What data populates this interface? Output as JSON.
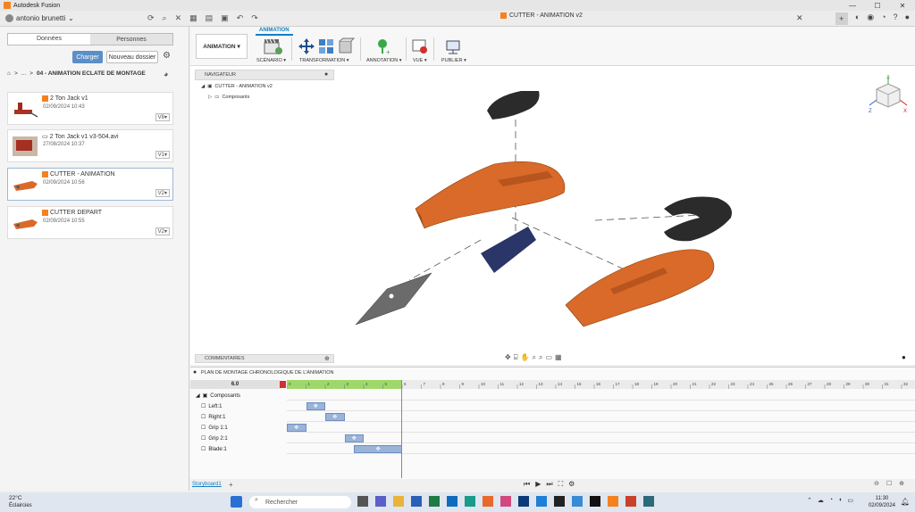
{
  "window": {
    "title": "Autodesk Fusion"
  },
  "appbar": {
    "user": "antonio brunetti"
  },
  "document": {
    "tab_title": "CUTTER - ANIMATION v2"
  },
  "left_panel": {
    "tabs": [
      "Données",
      "Personnes"
    ],
    "upload_label": "Charger",
    "new_folder_label": "Nouveau dossier",
    "breadcrumb": {
      "ellipsis": "...",
      "separator": ">",
      "folder": "04 - ANIMATION ECLATE DE MONTAGE"
    },
    "files": [
      {
        "name": "2 Ton Jack v1",
        "date": "02/09/2024 10:43",
        "version": "V8"
      },
      {
        "name": "2 Ton Jack v1 v3-504.avi",
        "date": "27/08/2024 10:37",
        "version": "V1"
      },
      {
        "name": "CUTTER - ANIMATION",
        "date": "02/09/2024 10:56",
        "version": "V2"
      },
      {
        "name": "CUTTER DEPART",
        "date": "02/09/2024 10:55",
        "version": "V2"
      }
    ]
  },
  "toolbar": {
    "workspace": "ANIMATION",
    "active_tab": "ANIMATION",
    "groups": [
      "SCÉNARIO",
      "TRANSFORMATION",
      "ANNOTATION",
      "VUE",
      "PUBLIER"
    ]
  },
  "browser": {
    "header": "NAVIGATEUR",
    "root": "CUTTER - ANIMATION v2",
    "child": "Composants",
    "comments": "COMMENTAIRES"
  },
  "viewcube": {
    "axis_y": "Y",
    "axis_z": "Z",
    "axis_x": "X"
  },
  "timeline": {
    "title": "PLAN DE MONTAGE CHRONOLOGIQUE DE L'ANIMATION",
    "time": "6.0",
    "root": "Composants",
    "tracks": [
      {
        "label": "Left:1",
        "start": 1,
        "end": 2
      },
      {
        "label": "Right:1",
        "start": 2,
        "end": 3
      },
      {
        "label": "Grip 1:1",
        "start": 0,
        "end": 1
      },
      {
        "label": "Grip 2:1",
        "start": 3,
        "end": 4
      },
      {
        "label": "Blade:1",
        "start": 3.5,
        "end": 6
      }
    ],
    "storyboard_tab": "Storyboard1",
    "ruler_labels": [
      "0",
      "1",
      "2",
      "3",
      "4",
      "5",
      "6",
      "7",
      "8",
      "9",
      "10",
      "11",
      "12",
      "13",
      "14",
      "15",
      "16",
      "17",
      "18",
      "19",
      "20",
      "21",
      "22",
      "23",
      "24",
      "25",
      "26",
      "27",
      "28",
      "29",
      "30",
      "31",
      "32"
    ]
  },
  "taskbar": {
    "weather_temp": "22°C",
    "weather_desc": "Éclaircies",
    "search_placeholder": "Rechercher",
    "time": "11:30",
    "date": "02/09/2024"
  }
}
